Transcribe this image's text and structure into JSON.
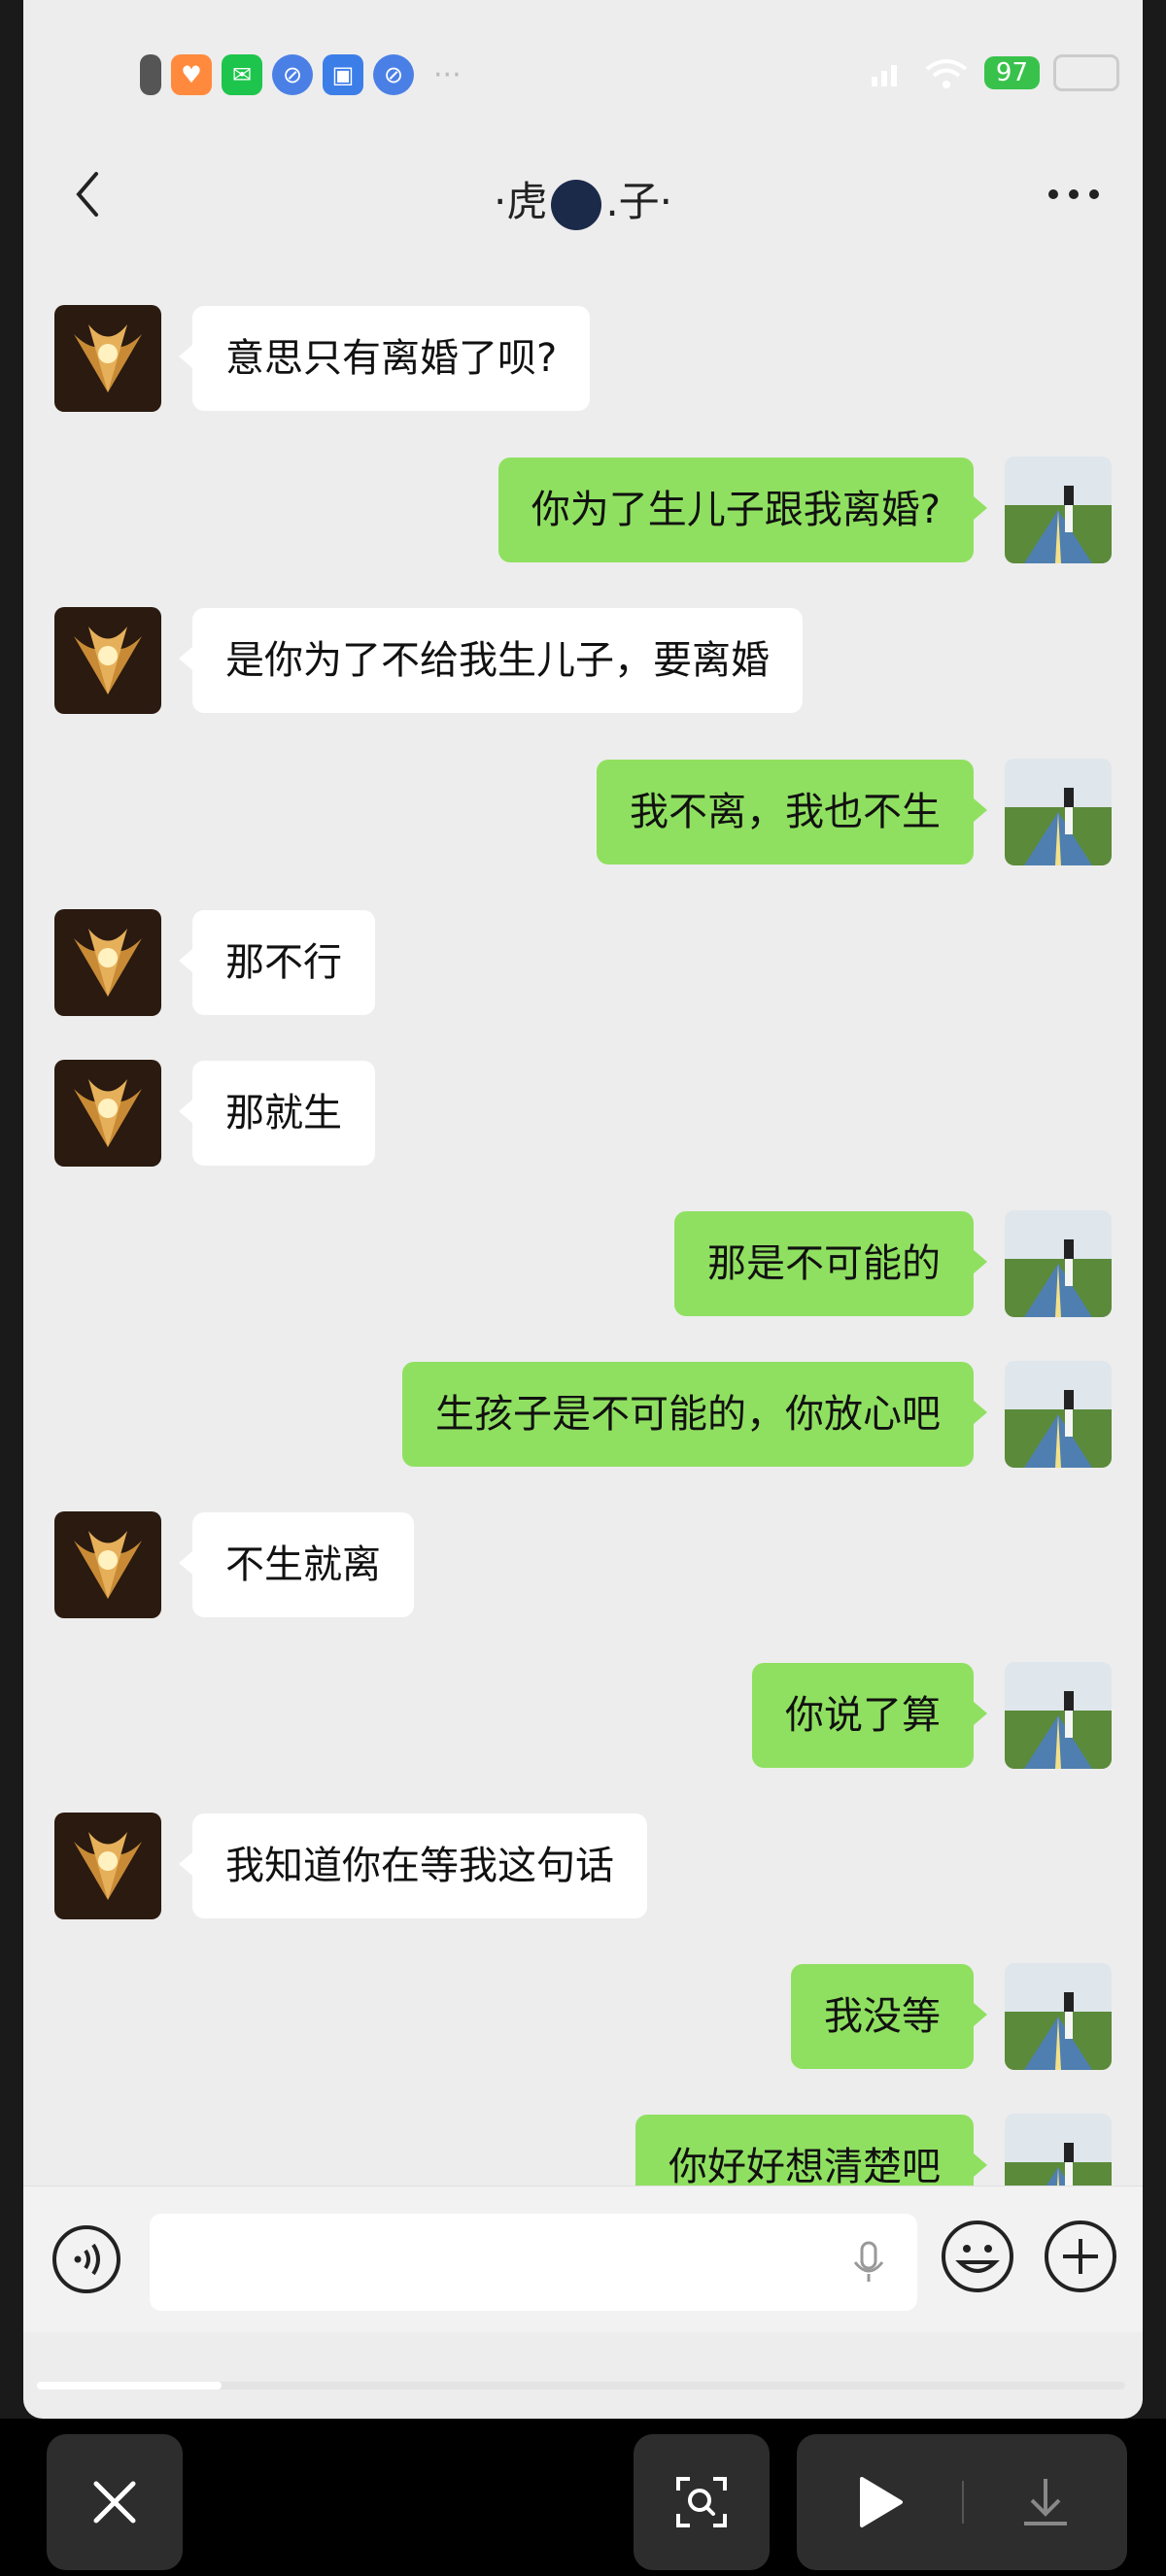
{
  "header": {
    "title_left": "·虎",
    "title_right": ".子·"
  },
  "statusbar": {
    "battery": "97"
  },
  "messages": [
    {
      "side": "left",
      "text": "意思只有离婚了呗?"
    },
    {
      "side": "right",
      "text": "你为了生儿子跟我离婚?"
    },
    {
      "side": "left",
      "text": "是你为了不给我生儿子，要离婚"
    },
    {
      "side": "right",
      "text": "我不离，我也不生"
    },
    {
      "side": "left",
      "text": "那不行"
    },
    {
      "side": "left",
      "text": "那就生"
    },
    {
      "side": "right",
      "text": "那是不可能的"
    },
    {
      "side": "right",
      "text": "生孩子是不可能的，你放心吧"
    },
    {
      "side": "left",
      "text": "不生就离"
    },
    {
      "side": "right",
      "text": "你说了算"
    },
    {
      "side": "left",
      "text": "我知道你在等我这句话"
    },
    {
      "side": "right",
      "text": "我没等"
    },
    {
      "side": "right",
      "text": "你好好想清楚吧"
    }
  ],
  "colors": {
    "incoming_bubble": "#ffffff",
    "outgoing_bubble": "#8fe060",
    "chat_background": "#ededed"
  },
  "icons": {
    "back": "chevron-left-icon",
    "more": "more-horizontal-icon",
    "voice": "voice-input-icon",
    "mic": "microphone-icon",
    "emoji": "emoji-icon",
    "plus": "plus-circle-icon",
    "close": "close-icon",
    "scan": "scan-search-icon",
    "play": "play-icon",
    "download": "download-icon"
  }
}
